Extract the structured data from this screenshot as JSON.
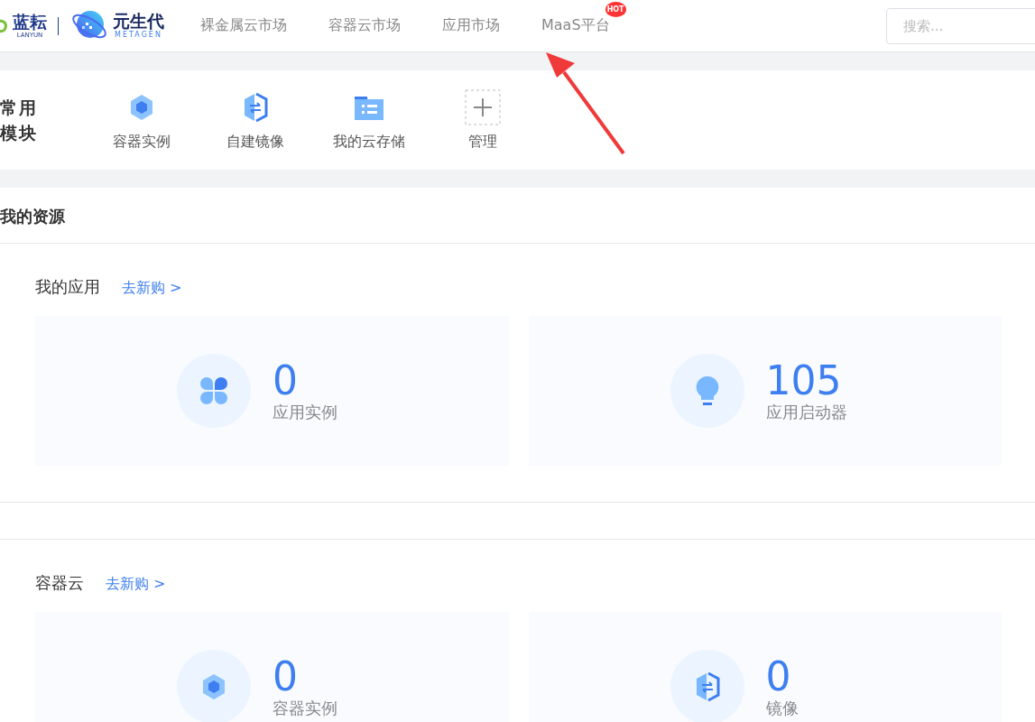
{
  "header": {
    "logo_primary": {
      "name": "蓝耘",
      "sub": "LANYUN"
    },
    "logo_secondary": {
      "name": "元生代",
      "sub": "METAGEN"
    },
    "nav": [
      {
        "label": "裸金属云市场"
      },
      {
        "label": "容器云市场"
      },
      {
        "label": "应用市场"
      },
      {
        "label": "MaaS平台",
        "badge": "HOT"
      }
    ],
    "search": {
      "placeholder": "搜索..."
    }
  },
  "quick_modules": {
    "title": "常用模块",
    "items": [
      {
        "label": "容器实例",
        "kind": "cube"
      },
      {
        "label": "自建镜像",
        "kind": "mirror"
      },
      {
        "label": "我的云存储",
        "kind": "folder"
      },
      {
        "label": "管理",
        "kind": "plus"
      }
    ]
  },
  "resources": {
    "title": "我的资源",
    "groups": [
      {
        "title": "我的应用",
        "link": "去新购 >",
        "cards": [
          {
            "value": "0",
            "label": "应用实例",
            "kind": "clover"
          },
          {
            "value": "105",
            "label": "应用启动器",
            "kind": "bulb"
          }
        ]
      },
      {
        "title": "容器云",
        "link": "去新购 >",
        "cards": [
          {
            "value": "0",
            "label": "容器实例",
            "kind": "cube"
          },
          {
            "value": "0",
            "label": "镜像",
            "kind": "mirror"
          }
        ]
      }
    ]
  },
  "annotation": {
    "kind": "arrow"
  }
}
